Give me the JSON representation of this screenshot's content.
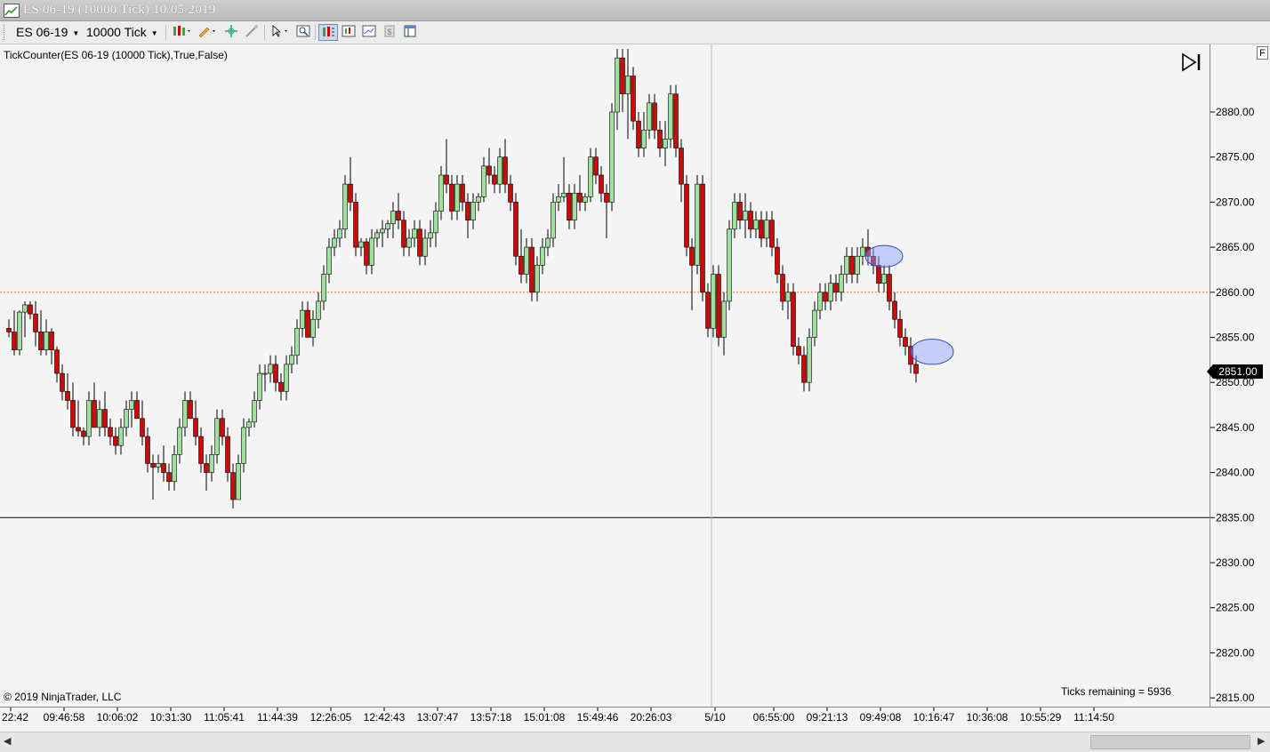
{
  "window": {
    "title": "ES 06-19 (10000 Tick)  10/05/2019"
  },
  "toolbar": {
    "instrument": "ES 06-19",
    "interval": "10000 Tick",
    "icons": [
      "bar-style-icon",
      "draw-pencil-icon",
      "crosshair-icon",
      "properties-icon",
      "cursor-icon",
      "zoom-icon",
      "chart-trader-icon",
      "data-box-icon",
      "analyzer-icon",
      "dollar-icon",
      "layout-icon"
    ]
  },
  "chart": {
    "indicator_label": "TickCounter(ES  06-19 (10000  Tick),True,False)",
    "copyright": "© 2019 NinjaTrader, LLC",
    "ticks_remaining": "Ticks remaining = 5936",
    "last_price": "2851.00",
    "corner_label": "F",
    "colors": {
      "up": "#9fe09f",
      "down": "#cc0a0a",
      "wick": "#000000",
      "price_line": "#ff6a3d",
      "horizontal_line": "#000000",
      "ellipse_fill": "#8c9fff",
      "ellipse_stroke": "#3a4fc0"
    }
  },
  "chart_data": {
    "type": "candlestick",
    "ylim": [
      2814,
      2884
    ],
    "y_ticks": [
      2815,
      2820,
      2825,
      2830,
      2835,
      2840,
      2845,
      2850,
      2855,
      2860,
      2865,
      2870,
      2875,
      2880
    ],
    "y_tick_labels": [
      "2815.00",
      "2820.00",
      "2825.00",
      "2830.00",
      "2835.00",
      "2840.00",
      "2845.00",
      "2850.00",
      "2855.00",
      "2860.00",
      "2865.00",
      "2870.00",
      "2875.00",
      "2880.00"
    ],
    "x_tick_labels": [
      "22:42",
      "09:46:58",
      "10:06:02",
      "10:31:30",
      "11:05:41",
      "11:44:39",
      "12:26:05",
      "12:42:43",
      "13:07:47",
      "13:57:18",
      "15:01:08",
      "15:49:46",
      "20:26:03",
      "5/10",
      "06:55:00",
      "09:21:13",
      "09:49:08",
      "10:16:47",
      "10:36:08",
      "10:55:29",
      "11:14:50"
    ],
    "x_tick_bar_index": [
      0,
      10,
      20,
      30,
      40,
      50,
      60,
      70,
      80,
      90,
      100,
      110,
      120,
      132,
      143,
      153,
      163,
      173,
      183,
      193,
      203
    ],
    "candles": [
      [
        2856.0,
        2857.0,
        2855.0,
        2855.6
      ],
      [
        2855.6,
        2858.0,
        2853.0,
        2853.6
      ],
      [
        2853.6,
        2858.0,
        2853.0,
        2857.8
      ],
      [
        2857.8,
        2859.0,
        2855.0,
        2858.6
      ],
      [
        2858.6,
        2859.0,
        2857.0,
        2857.6
      ],
      [
        2857.6,
        2859.0,
        2854.0,
        2855.6
      ],
      [
        2855.6,
        2858.0,
        2853.0,
        2853.6
      ],
      [
        2853.6,
        2857.0,
        2853.0,
        2855.6
      ],
      [
        2855.6,
        2856.0,
        2852.0,
        2853.6
      ],
      [
        2853.6,
        2854.0,
        2850.0,
        2851.0
      ],
      [
        2851.0,
        2852.0,
        2848.0,
        2849.0
      ],
      [
        2849.0,
        2851.0,
        2847.0,
        2848.0
      ],
      [
        2848.0,
        2850.0,
        2844.0,
        2845.0
      ],
      [
        2845.0,
        2848.0,
        2844.0,
        2844.6
      ],
      [
        2844.6,
        2845.0,
        2843.0,
        2844.0
      ],
      [
        2844.0,
        2849.0,
        2843.0,
        2848.0
      ],
      [
        2848.0,
        2850.0,
        2845.0,
        2845.0
      ],
      [
        2845.0,
        2848.0,
        2844.0,
        2847.0
      ],
      [
        2847.0,
        2849.0,
        2844.0,
        2845.0
      ],
      [
        2845.0,
        2846.0,
        2843.0,
        2844.0
      ],
      [
        2844.0,
        2845.0,
        2842.0,
        2843.0
      ],
      [
        2843.0,
        2846.0,
        2842.0,
        2845.0
      ],
      [
        2845.0,
        2848.0,
        2844.0,
        2847.0
      ],
      [
        2847.0,
        2849.0,
        2845.0,
        2848.0
      ],
      [
        2848.0,
        2849.0,
        2846.0,
        2846.0
      ],
      [
        2846.0,
        2848.0,
        2843.0,
        2844.0
      ],
      [
        2844.0,
        2845.0,
        2840.0,
        2841.0
      ],
      [
        2841.0,
        2842.0,
        2837.0,
        2840.6
      ],
      [
        2840.6,
        2842.0,
        2840.0,
        2841.0
      ],
      [
        2841.0,
        2843.0,
        2839.0,
        2840.0
      ],
      [
        2840.0,
        2841.0,
        2838.0,
        2839.0
      ],
      [
        2839.0,
        2843.0,
        2838.0,
        2842.0
      ],
      [
        2842.0,
        2846.0,
        2841.0,
        2845.0
      ],
      [
        2845.0,
        2849.0,
        2844.0,
        2848.0
      ],
      [
        2848.0,
        2849.0,
        2846.0,
        2846.0
      ],
      [
        2846.0,
        2848.0,
        2843.0,
        2844.0
      ],
      [
        2844.0,
        2845.0,
        2840.0,
        2841.0
      ],
      [
        2841.0,
        2842.0,
        2838.0,
        2840.0
      ],
      [
        2840.0,
        2843.0,
        2839.0,
        2842.0
      ],
      [
        2842.0,
        2847.0,
        2841.0,
        2846.0
      ],
      [
        2846.0,
        2847.0,
        2843.0,
        2844.0
      ],
      [
        2844.0,
        2845.0,
        2839.0,
        2840.0
      ],
      [
        2840.0,
        2841.0,
        2836.0,
        2837.0
      ],
      [
        2837.0,
        2842.0,
        2837.0,
        2841.0
      ],
      [
        2841.0,
        2846.0,
        2840.0,
        2845.0
      ],
      [
        2845.0,
        2846.0,
        2844.0,
        2845.6
      ],
      [
        2845.6,
        2849.0,
        2845.0,
        2848.0
      ],
      [
        2848.0,
        2852.0,
        2847.0,
        2851.0
      ],
      [
        2851.0,
        2852.0,
        2849.0,
        2851.0
      ],
      [
        2851.0,
        2853.0,
        2850.0,
        2852.0
      ],
      [
        2852.0,
        2853.0,
        2849.0,
        2850.0
      ],
      [
        2850.0,
        2851.0,
        2848.0,
        2849.0
      ],
      [
        2849.0,
        2853.0,
        2848.0,
        2852.0
      ],
      [
        2852.0,
        2854.0,
        2851.0,
        2853.0
      ],
      [
        2853.0,
        2857.0,
        2852.0,
        2856.0
      ],
      [
        2856.0,
        2859.0,
        2855.0,
        2858.0
      ],
      [
        2858.0,
        2859.0,
        2855.0,
        2855.0
      ],
      [
        2855.0,
        2858.0,
        2854.0,
        2857.0
      ],
      [
        2857.0,
        2860.0,
        2856.0,
        2859.0
      ],
      [
        2859.0,
        2863.0,
        2858.0,
        2862.0
      ],
      [
        2862.0,
        2866.0,
        2861.0,
        2865.0
      ],
      [
        2865.0,
        2867.0,
        2864.0,
        2866.0
      ],
      [
        2866.0,
        2868.0,
        2865.0,
        2867.0
      ],
      [
        2867.0,
        2873.0,
        2866.0,
        2872.0
      ],
      [
        2872.0,
        2875.0,
        2869.0,
        2870.0
      ],
      [
        2870.0,
        2871.0,
        2864.0,
        2865.0
      ],
      [
        2865.0,
        2866.0,
        2864.0,
        2865.6
      ],
      [
        2865.6,
        2866.0,
        2862.0,
        2863.0
      ],
      [
        2863.0,
        2867.0,
        2862.0,
        2866.0
      ],
      [
        2866.0,
        2867.0,
        2865.0,
        2866.6
      ],
      [
        2866.6,
        2868.0,
        2865.0,
        2867.0
      ],
      [
        2867.0,
        2868.0,
        2866.0,
        2867.6
      ],
      [
        2867.6,
        2870.0,
        2866.0,
        2869.0
      ],
      [
        2869.0,
        2871.0,
        2867.0,
        2868.0
      ],
      [
        2868.0,
        2869.0,
        2864.0,
        2865.0
      ],
      [
        2865.0,
        2867.0,
        2864.0,
        2866.0
      ],
      [
        2866.0,
        2868.0,
        2865.0,
        2867.0
      ],
      [
        2867.0,
        2868.0,
        2863.0,
        2864.0
      ],
      [
        2864.0,
        2867.0,
        2863.0,
        2866.0
      ],
      [
        2866.0,
        2868.0,
        2865.0,
        2866.6
      ],
      [
        2866.6,
        2870.0,
        2865.0,
        2869.0
      ],
      [
        2869.0,
        2874.0,
        2868.0,
        2873.0
      ],
      [
        2873.0,
        2877.0,
        2871.0,
        2872.0
      ],
      [
        2872.0,
        2873.0,
        2868.0,
        2869.0
      ],
      [
        2869.0,
        2873.0,
        2868.0,
        2872.0
      ],
      [
        2872.0,
        2873.0,
        2869.0,
        2870.0
      ],
      [
        2870.0,
        2871.0,
        2866.0,
        2868.0
      ],
      [
        2868.0,
        2871.0,
        2867.0,
        2870.0
      ],
      [
        2870.0,
        2871.0,
        2869.0,
        2870.6
      ],
      [
        2870.6,
        2875.0,
        2870.0,
        2874.0
      ],
      [
        2874.0,
        2876.0,
        2872.0,
        2873.0
      ],
      [
        2873.0,
        2874.0,
        2871.0,
        2872.0
      ],
      [
        2872.0,
        2876.0,
        2871.0,
        2875.0
      ],
      [
        2875.0,
        2877.0,
        2871.0,
        2872.0
      ],
      [
        2872.0,
        2873.0,
        2869.0,
        2870.0
      ],
      [
        2870.0,
        2871.0,
        2863.0,
        2864.0
      ],
      [
        2864.0,
        2867.0,
        2861.0,
        2862.0
      ],
      [
        2862.0,
        2866.0,
        2861.0,
        2865.0
      ],
      [
        2865.0,
        2866.0,
        2859.0,
        2860.0
      ],
      [
        2860.0,
        2864.0,
        2859.0,
        2863.0
      ],
      [
        2863.0,
        2866.0,
        2862.0,
        2865.0
      ],
      [
        2865.0,
        2867.0,
        2864.0,
        2866.0
      ],
      [
        2866.0,
        2871.0,
        2865.0,
        2870.0
      ],
      [
        2870.0,
        2872.0,
        2869.0,
        2870.6
      ],
      [
        2870.6,
        2875.0,
        2870.0,
        2871.0
      ],
      [
        2871.0,
        2872.0,
        2867.0,
        2868.0
      ],
      [
        2868.0,
        2872.0,
        2867.0,
        2871.0
      ],
      [
        2871.0,
        2873.0,
        2869.0,
        2870.0
      ],
      [
        2870.0,
        2871.0,
        2869.0,
        2870.6
      ],
      [
        2870.6,
        2876.0,
        2870.0,
        2875.0
      ],
      [
        2875.0,
        2876.0,
        2872.0,
        2873.0
      ],
      [
        2873.0,
        2874.0,
        2870.0,
        2871.0
      ],
      [
        2871.0,
        2872.0,
        2866.0,
        2870.0
      ],
      [
        2870.0,
        2881.0,
        2869.0,
        2880.0
      ],
      [
        2880.0,
        2887.0,
        2878.0,
        2886.0
      ],
      [
        2886.0,
        2887.0,
        2880.0,
        2882.0
      ],
      [
        2882.0,
        2887.0,
        2877.0,
        2884.0
      ],
      [
        2884.0,
        2885.0,
        2878.0,
        2879.0
      ],
      [
        2879.0,
        2880.0,
        2875.0,
        2876.0
      ],
      [
        2876.0,
        2880.0,
        2875.0,
        2878.0
      ],
      [
        2878.0,
        2882.0,
        2877.0,
        2881.0
      ],
      [
        2881.0,
        2882.0,
        2877.0,
        2878.0
      ],
      [
        2878.0,
        2879.0,
        2875.0,
        2876.0
      ],
      [
        2876.0,
        2879.0,
        2874.0,
        2877.0
      ],
      [
        2877.0,
        2883.0,
        2876.0,
        2882.0
      ],
      [
        2882.0,
        2883.0,
        2875.0,
        2876.0
      ],
      [
        2876.0,
        2877.0,
        2870.0,
        2872.0
      ],
      [
        2872.0,
        2873.0,
        2864.0,
        2865.0
      ],
      [
        2865.0,
        2866.0,
        2858.0,
        2863.0
      ],
      [
        2863.0,
        2873.0,
        2862.0,
        2872.0
      ],
      [
        2872.0,
        2873.0,
        2859.0,
        2860.0
      ],
      [
        2860.0,
        2861.0,
        2855.0,
        2856.0
      ],
      [
        2856.0,
        2863.0,
        2855.0,
        2862.0
      ],
      [
        2862.0,
        2863.0,
        2854.0,
        2855.0
      ],
      [
        2855.0,
        2860.0,
        2853.0,
        2859.0
      ],
      [
        2859.0,
        2868.0,
        2858.0,
        2867.0
      ],
      [
        2867.0,
        2871.0,
        2866.0,
        2870.0
      ],
      [
        2870.0,
        2871.0,
        2867.0,
        2868.0
      ],
      [
        2868.0,
        2871.0,
        2866.0,
        2869.0
      ],
      [
        2869.0,
        2870.0,
        2866.0,
        2867.0
      ],
      [
        2867.0,
        2869.0,
        2866.0,
        2868.0
      ],
      [
        2868.0,
        2869.0,
        2865.0,
        2866.0
      ],
      [
        2866.0,
        2869.0,
        2865.0,
        2868.0
      ],
      [
        2868.0,
        2869.0,
        2864.0,
        2865.0
      ],
      [
        2865.0,
        2866.0,
        2861.0,
        2862.0
      ],
      [
        2862.0,
        2863.0,
        2858.0,
        2859.0
      ],
      [
        2859.0,
        2861.0,
        2857.0,
        2860.0
      ],
      [
        2860.0,
        2861.0,
        2853.0,
        2854.0
      ],
      [
        2854.0,
        2855.0,
        2852.0,
        2853.0
      ],
      [
        2853.0,
        2854.0,
        2849.0,
        2850.0
      ],
      [
        2850.0,
        2856.0,
        2849.0,
        2855.0
      ],
      [
        2855.0,
        2859.0,
        2854.0,
        2858.0
      ],
      [
        2858.0,
        2861.0,
        2857.0,
        2860.0
      ],
      [
        2860.0,
        2861.0,
        2858.0,
        2859.0
      ],
      [
        2859.0,
        2862.0,
        2858.0,
        2861.0
      ],
      [
        2861.0,
        2862.0,
        2859.0,
        2860.0
      ],
      [
        2860.0,
        2863.0,
        2859.0,
        2862.0
      ],
      [
        2862.0,
        2865.0,
        2861.0,
        2864.0
      ],
      [
        2864.0,
        2865.0,
        2861.0,
        2862.0
      ],
      [
        2862.0,
        2865.0,
        2861.0,
        2864.0
      ],
      [
        2864.0,
        2866.0,
        2863.0,
        2865.0
      ],
      [
        2865.0,
        2867.0,
        2863.0,
        2864.0
      ],
      [
        2864.0,
        2865.0,
        2862.0,
        2863.0
      ],
      [
        2863.0,
        2864.0,
        2860.0,
        2861.0
      ],
      [
        2861.0,
        2863.0,
        2860.0,
        2862.0
      ],
      [
        2862.0,
        2863.0,
        2858.0,
        2859.0
      ],
      [
        2859.0,
        2860.0,
        2856.0,
        2857.0
      ],
      [
        2857.0,
        2858.0,
        2854.0,
        2855.0
      ],
      [
        2855.0,
        2856.0,
        2853.0,
        2854.0
      ],
      [
        2854.0,
        2855.0,
        2851.0,
        2852.0
      ],
      [
        2852.0,
        2853.0,
        2850.0,
        2851.0
      ]
    ],
    "annotations": [
      {
        "type": "horizontal_line",
        "y": 2860.0,
        "style": "dotted",
        "color": "#ff6a3d"
      },
      {
        "type": "horizontal_line",
        "y": 2835.0,
        "style": "solid",
        "color": "#000000"
      },
      {
        "type": "vertical_line",
        "bar_index": 132,
        "style": "solid",
        "color": "#bdbdbd"
      },
      {
        "type": "ellipse",
        "bar_index": 164,
        "y": 2864.0,
        "rx_bars": 3.5,
        "ry_price": 1.2
      },
      {
        "type": "ellipse",
        "bar_index": 173,
        "y": 2853.4,
        "rx_bars": 4,
        "ry_price": 1.4
      }
    ]
  }
}
